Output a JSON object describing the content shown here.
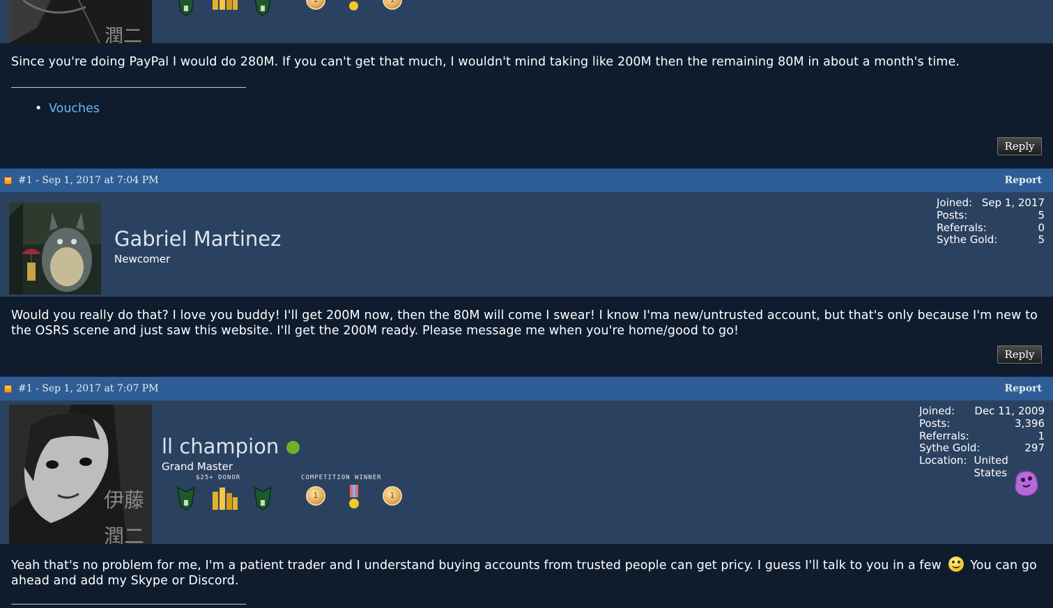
{
  "post0": {
    "message": "Since you're doing PayPal I would do 280M. If you can't get that much, I wouldn't mind taking like 200M then the remaining 80M in about a month's time.",
    "signature_link": "Vouches",
    "reply_label": "Reply"
  },
  "post1": {
    "header_date": "#1 - Sep 1, 2017 at 7:04 PM",
    "report_label": "Report",
    "username": "Gabriel Martinez",
    "rank": "Newcomer",
    "stats": [
      {
        "label": "Joined:",
        "value": "Sep 1, 2017"
      },
      {
        "label": "Posts:",
        "value": "5"
      },
      {
        "label": "Referrals:",
        "value": "0"
      },
      {
        "label": "Sythe Gold:",
        "value": "5"
      }
    ],
    "message": "Would you really do that? I love you buddy! I'll get 200M now, then the 80M will come I swear! I know I'ma new/untrusted account, but that's only because I'm new to the OSRS scene and just saw this website. I'll get the 200M ready. Please message me when you're home/good to go!",
    "reply_label": "Reply"
  },
  "post2": {
    "header_date": "#1 - Sep 1, 2017 at 7:07 PM",
    "report_label": "Report",
    "username": "ll champion",
    "rank": "Grand Master",
    "badge_donor_label": "$25+ DONOR",
    "badge_competition_label": "COMPETITION WINNER",
    "avatar_text_1": "伊藤",
    "avatar_text_2": "潤二",
    "stats": [
      {
        "label": "Joined:",
        "value": "Dec 11, 2009"
      },
      {
        "label": "Posts:",
        "value": "3,396"
      },
      {
        "label": "Referrals:",
        "value": "1"
      },
      {
        "label": "Sythe Gold:",
        "value": "297"
      },
      {
        "label": "Location:",
        "value": "United States"
      }
    ],
    "message_part1": "Yeah that's no problem for me, I'm a patient trader and I understand buying accounts from trusted people can get pricy. I guess I'll talk to you in a few",
    "message_part2": "You can go ahead and add my Skype or Discord."
  },
  "top_avatar_text": "潤二",
  "colors": {
    "page_bg": "#0f1c2e",
    "user_area_bg": "#2b4160",
    "post_header_bg": "#2d5d94",
    "link": "#6fb4ee",
    "online": "#6fb12b"
  }
}
